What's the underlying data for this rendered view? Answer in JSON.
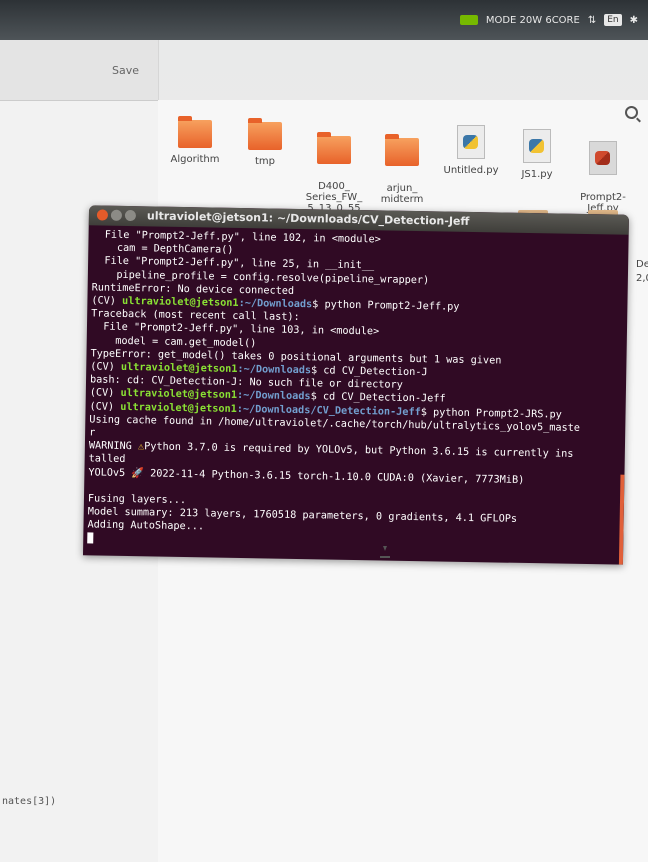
{
  "topbar": {
    "mode": "MODE 20W 6CORE",
    "language": "En"
  },
  "editor": {
    "save_label": "Save",
    "code_fragment": "nates[3])"
  },
  "file_manager": {
    "files": [
      {
        "name": "Algorithm",
        "type": "folder"
      },
      {
        "name": "tmp",
        "type": "folder"
      },
      {
        "name": "D400_\nSeries_FW_\n5_13_0_55",
        "type": "folder"
      },
      {
        "name": "arjun_\nmidterm",
        "type": "folder"
      },
      {
        "name": "Untitled.py",
        "type": "python"
      },
      {
        "name": "JS1.py",
        "type": "python"
      },
      {
        "name": "Prompt2-\nJeff.py",
        "type": "python-selected"
      }
    ],
    "side_text": "De\n2,0"
  },
  "terminal": {
    "title": "ultraviolet@jetson1: ~/Downloads/CV_Detection-Jeff",
    "user": "ultraviolet@jetson1",
    "lines": {
      "l1": "  File \"Prompt2-Jeff.py\", line 102, in <module>",
      "l2": "    cam = DepthCamera()",
      "l3": "  File \"Prompt2-Jeff.py\", line 25, in __init__",
      "l4": "    pipeline_profile = config.resolve(pipeline_wrapper)",
      "l5": "RuntimeError: No device connected",
      "l6_prefix": "(CV) ",
      "l6_path": ":~/Downloads",
      "l6_cmd": "$ python Prompt2-Jeff.py",
      "l7": "Traceback (most recent call last):",
      "l8": "  File \"Prompt2-Jeff.py\", line 103, in <module>",
      "l9": "    model = cam.get_model()",
      "l10": "TypeError: get_model() takes 0 positional arguments but 1 was given",
      "l11_cmd": "$ cd CV_Detection-J",
      "l12": "bash: cd: CV_Detection-J: No such file or directory",
      "l13_cmd": "$ cd CV_Detection-Jeff",
      "l14_path": ":~/Downloads/CV_Detection-Jeff",
      "l14_cmd": "$ python Prompt2-JRS.py",
      "l15": "Using cache found in /home/ultraviolet/.cache/torch/hub/ultralytics_yolov5_maste",
      "l16": "r",
      "l17_a": "WARNING ",
      "l17_warn": "⚠",
      "l17_b": "Python 3.7.0 is required by YOLOv5, but Python 3.6.15 is currently ins",
      "l18": "talled",
      "l19": "YOLOv5 🚀 2022-11-4 Python-3.6.15 torch-1.10.0 CUDA:0 (Xavier, 7773MiB)",
      "l20": "",
      "l21": "Fusing layers...",
      "l22": "Model summary: 213 layers, 1760518 parameters, 0 gradients, 4.1 GFLOPs",
      "l23": "Adding AutoShape..."
    }
  }
}
